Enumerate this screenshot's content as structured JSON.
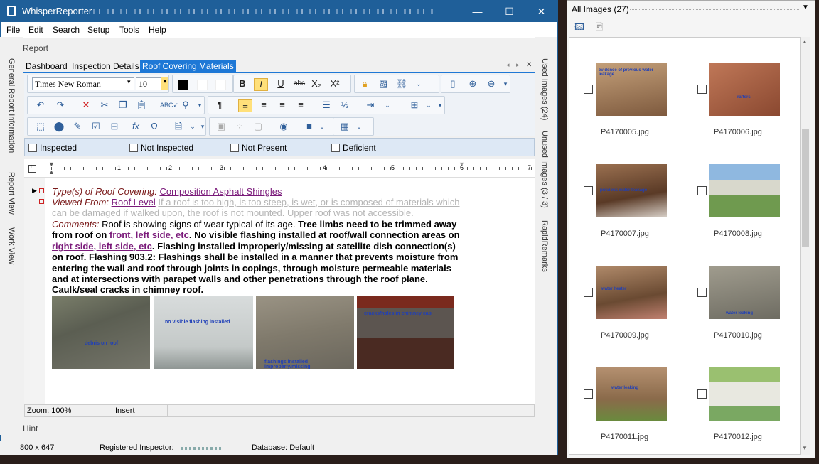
{
  "window": {
    "title": "WhisperReporter",
    "minimize": "—",
    "maximize": "☐",
    "close": "✕"
  },
  "menu": [
    "File",
    "Edit",
    "Search",
    "Setup",
    "Tools",
    "Help"
  ],
  "side_left": [
    "General Report Information",
    "Report View",
    "Work View"
  ],
  "side_right": [
    "Used Images (24)",
    "Unused Images (3 / 3)",
    "RapidRemarks"
  ],
  "report_label": "Report",
  "tabs": [
    "Dashboard",
    "Inspection Details",
    "Roof Covering Materials"
  ],
  "toolbar": {
    "font": "Times New Roman",
    "size": "10"
  },
  "checks": [
    "Inspected",
    "Not Inspected",
    "Not Present",
    "Deficient"
  ],
  "ruler_numbers": [
    "1",
    "2",
    "3",
    "4",
    "5",
    "6",
    "7"
  ],
  "content": {
    "type_label": "Type(s) of Roof Covering:",
    "type_value": "Composition Asphalt Shingles",
    "viewed_label": "Viewed From:",
    "viewed_value": "Roof Level",
    "viewed_gray": "If a roof is too high, is too steep, is wet, or is composed of materials which can be damaged if walked upon, the roof is not mounted. Upper roof was not accessible.",
    "comments_label": "Comments:",
    "c1": "Roof is showing signs of wear typical of its age.",
    "c2": "Tree limbs need to be trimmed away from roof on",
    "c2link": "front, left side, etc",
    "c3": ". No visible flashing installed at roof/wall connection areas on",
    "c3link": "right side, left side, etc",
    "c4": ". Flashing installed improperly/missing at satellite dish connection(s) on roof. Flashing 903.2: Flashings shall be installed in a manner that prevents moisture from entering the wall and roof through joints in copings, through moisture permeable materials and at intersections with parapet walls and other penetrations through the roof plane. Caulk/seal cracks in chimney roof."
  },
  "photos": [
    {
      "label": "debris on roof",
      "color": "#6a6a5e"
    },
    {
      "label": "no visible flashing installed",
      "color": "#cfd3d2"
    },
    {
      "label": "flashings installed improperly/missing",
      "color": "#8a8577"
    },
    {
      "label": "cracks/holes in chimney cap",
      "color": "#4f4b47"
    }
  ],
  "status": {
    "zoom": "Zoom: 100%",
    "mode": "Insert"
  },
  "hint": "Hint",
  "bottom": {
    "size": "800 x 647",
    "inspector": "Registered Inspector:",
    "db": "Database: Default"
  },
  "panel": {
    "title": "All Images (27)"
  },
  "images": [
    {
      "name": "P4170005.jpg",
      "label": "evidence of previous water leakage",
      "color": "#9b7a5c"
    },
    {
      "name": "P4170006.jpg",
      "label": "rafters",
      "color": "#a0604a"
    },
    {
      "name": "P4170007.jpg",
      "label": "previous water leakage",
      "color": "#7a5a3e"
    },
    {
      "name": "P4170008.jpg",
      "label": "",
      "color": "#6f9a4f"
    },
    {
      "name": "P4170009.jpg",
      "label": "water heater",
      "color": "#8a6a52"
    },
    {
      "name": "P4170010.jpg",
      "label": "water leaking",
      "color": "#8b887c"
    },
    {
      "name": "P4170011.jpg",
      "label": "water leaking",
      "color": "#9a7e62"
    },
    {
      "name": "P4170012.jpg",
      "label": "",
      "color": "#7aa862"
    }
  ]
}
